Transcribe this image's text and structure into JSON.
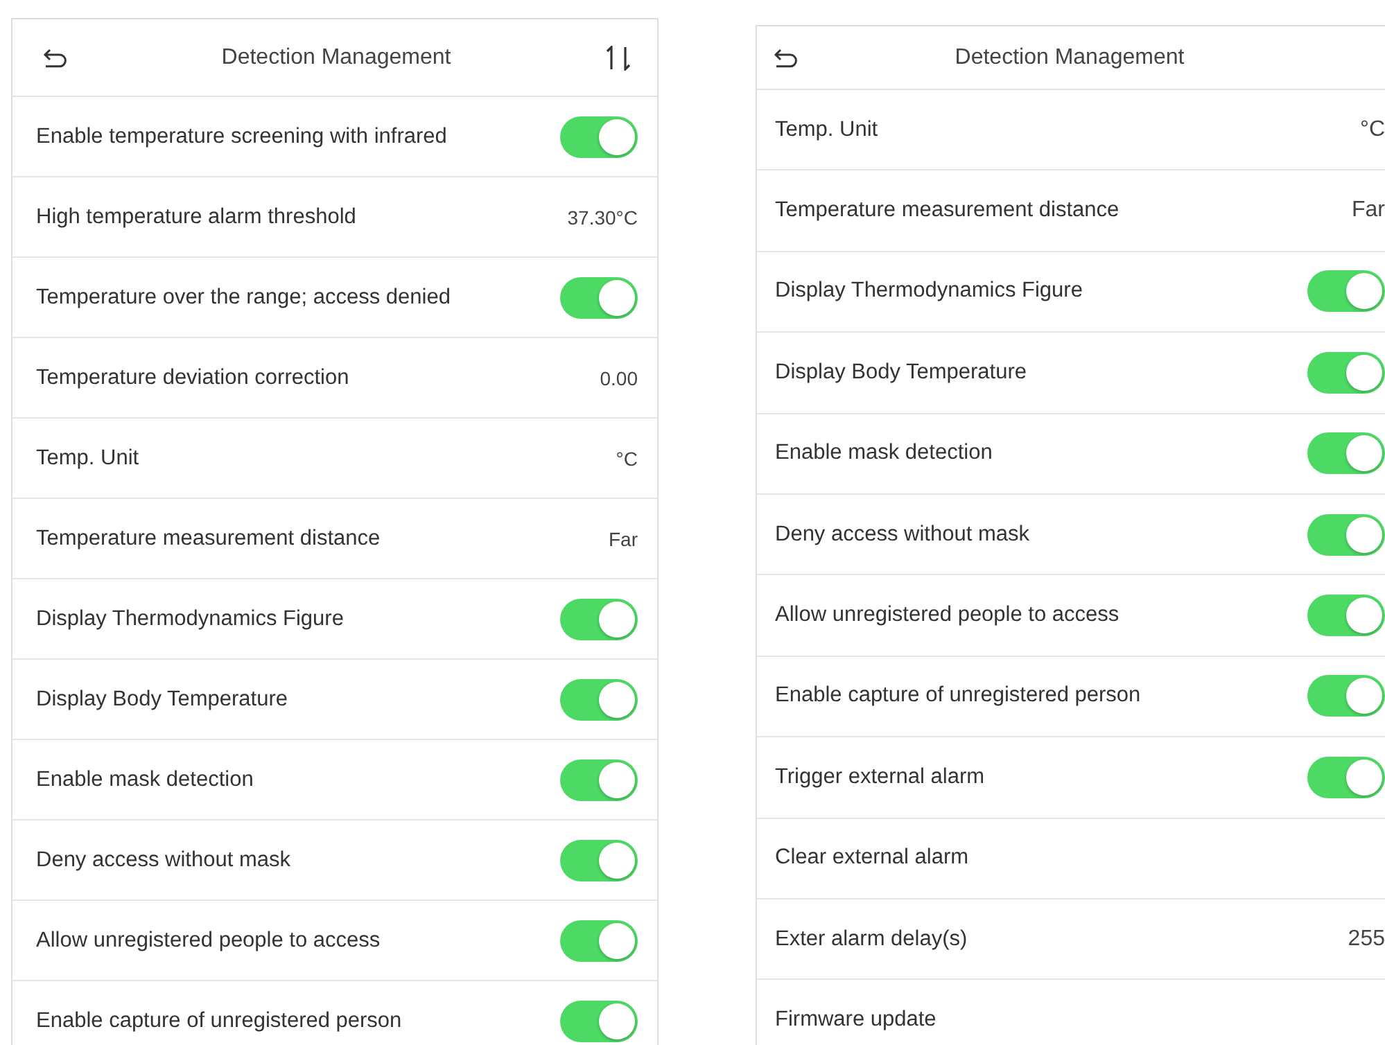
{
  "panels": [
    {
      "title": "Detection Management",
      "sort_button": true,
      "rows": [
        {
          "kind": "toggle",
          "label": "Enable temperature screening with infrared",
          "on": true
        },
        {
          "kind": "value",
          "label": "High temperature alarm threshold",
          "value": "37.30°C"
        },
        {
          "kind": "toggle",
          "label": "Temperature over the range; access denied",
          "on": true
        },
        {
          "kind": "value",
          "label": "Temperature deviation correction",
          "value": "0.00"
        },
        {
          "kind": "value",
          "label": "Temp. Unit",
          "value": "°C"
        },
        {
          "kind": "value",
          "label": "Temperature measurement distance",
          "value": "Far"
        },
        {
          "kind": "toggle",
          "label": "Display Thermodynamics Figure",
          "on": true
        },
        {
          "kind": "toggle",
          "label": "Display Body Temperature",
          "on": true
        },
        {
          "kind": "toggle",
          "label": "Enable mask detection",
          "on": true
        },
        {
          "kind": "toggle",
          "label": "Deny access without mask",
          "on": true
        },
        {
          "kind": "toggle",
          "label": "Allow unregistered people to access",
          "on": true
        },
        {
          "kind": "toggle",
          "label": "Enable capture of unregistered person",
          "on": true
        }
      ]
    },
    {
      "title": "Detection Management",
      "rows": [
        {
          "kind": "value",
          "label": "Temp. Unit",
          "value": "°C"
        },
        {
          "kind": "value",
          "label": "Temperature measurement distance",
          "value": "Far"
        },
        {
          "kind": "toggle",
          "label": "Display Thermodynamics Figure",
          "on": true
        },
        {
          "kind": "toggle",
          "label": "Display Body Temperature",
          "on": true
        },
        {
          "kind": "toggle",
          "label": "Enable mask detection",
          "on": true
        },
        {
          "kind": "toggle",
          "label": "Deny access without mask",
          "on": true
        },
        {
          "kind": "toggle",
          "label": "Allow unregistered people to access",
          "on": true
        },
        {
          "kind": "toggle",
          "label": "Enable capture of unregistered person",
          "on": true
        },
        {
          "kind": "toggle",
          "label": "Trigger external alarm",
          "on": true
        },
        {
          "kind": "plain",
          "label": "Clear external alarm"
        },
        {
          "kind": "value",
          "label": "Exter alarm delay(s)",
          "value": "255"
        },
        {
          "kind": "plain",
          "label": "Firmware update"
        }
      ]
    }
  ]
}
